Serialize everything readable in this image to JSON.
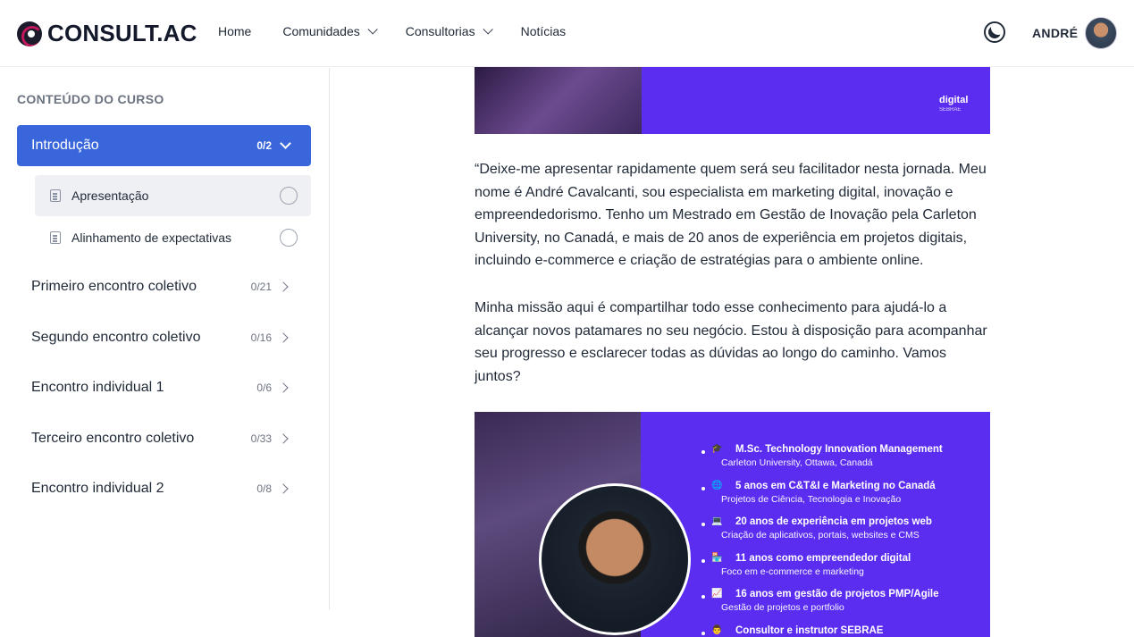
{
  "header": {
    "logo_text": "CONSULT.AC",
    "nav": [
      {
        "label": "Home",
        "dropdown": false
      },
      {
        "label": "Comunidades",
        "dropdown": true
      },
      {
        "label": "Consultorias",
        "dropdown": true
      },
      {
        "label": "Notícias",
        "dropdown": false
      }
    ],
    "user_name": "ANDRÉ"
  },
  "sidebar": {
    "title": "CONTEÚDO DO CURSO",
    "active_module": {
      "label": "Introdução",
      "count": "0/2"
    },
    "lessons": [
      {
        "label": "Apresentação",
        "active": true
      },
      {
        "label": "Alinhamento de expectativas",
        "active": false
      }
    ],
    "modules": [
      {
        "label": "Primeiro encontro coletivo",
        "count": "0/21"
      },
      {
        "label": "Segundo encontro coletivo",
        "count": "0/16"
      },
      {
        "label": "Encontro individual 1",
        "count": "0/6"
      },
      {
        "label": "Terceiro encontro coletivo",
        "count": "0/33"
      },
      {
        "label": "Encontro individual 2",
        "count": "0/8"
      }
    ]
  },
  "content": {
    "banner_brand": "digital",
    "banner_brand_sub": "SEBRAE",
    "paragraph_1": "“Deixe-me apresentar rapidamente quem será seu facilitador nesta jornada. Meu nome é André Cavalcanti, sou especialista em marketing digital, inovação e empreendedorismo. Tenho um Mestrado em Gestão de Inovação pela Carleton University, no Canadá, e mais de 20 anos de experiência em projetos digitais, incluindo e-commerce e criação de estratégias para o ambiente online.",
    "paragraph_2": "Minha missão aqui é compartilhar todo esse conhecimento para ajudá-lo a alcançar novos patamares no seu negócio. Estou à disposição para acompanhar seu progresso e esclarecer todas as dúvidas ao longo do caminho. Vamos juntos?",
    "credentials": [
      {
        "icon": "🎓",
        "title": "M.Sc. Technology Innovation Management",
        "sub": "Carleton University, Ottawa, Canadá"
      },
      {
        "icon": "🌐",
        "title": "5 anos em C&T&I e Marketing no Canadá",
        "sub": "Projetos de Ciência, Tecnologia e Inovação"
      },
      {
        "icon": "💻",
        "title": "20 anos de experiência em projetos web",
        "sub": "Criação de aplicativos, portais, websites e CMS"
      },
      {
        "icon": "🏪",
        "title": "11 anos como empreendedor digital",
        "sub": "Foco em e-commerce e marketing"
      },
      {
        "icon": "📈",
        "title": "16 anos em gestão de projetos PMP/Agile",
        "sub": "Gestão de projetos e portfolio"
      },
      {
        "icon": "👨",
        "title": "Consultor e instrutor SEBRAE",
        "sub": ""
      }
    ]
  }
}
